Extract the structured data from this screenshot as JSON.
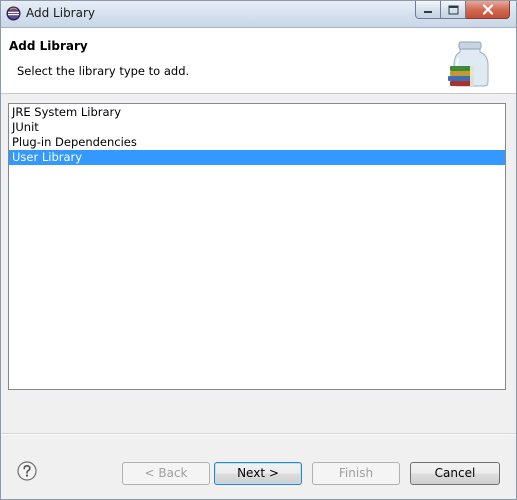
{
  "window": {
    "title": "Add Library",
    "controls": [
      "minimize",
      "maximize",
      "close"
    ]
  },
  "header": {
    "title": "Add Library",
    "description": "Select the library type to add."
  },
  "library_types": {
    "items": [
      {
        "label": "JRE System Library",
        "selected": false
      },
      {
        "label": "JUnit",
        "selected": false
      },
      {
        "label": "Plug-in Dependencies",
        "selected": false
      },
      {
        "label": "User Library",
        "selected": true
      }
    ]
  },
  "buttons": {
    "back": {
      "label": "< Back",
      "enabled": false
    },
    "next": {
      "label": "Next >",
      "enabled": true,
      "default": true
    },
    "finish": {
      "label": "Finish",
      "enabled": false
    },
    "cancel": {
      "label": "Cancel",
      "enabled": true
    }
  },
  "icons": {
    "app": "eclipse-icon",
    "banner": "library-jar-icon",
    "help": "help-icon"
  },
  "colors": {
    "selection": "#3399ff",
    "selection_text": "#ffffff",
    "close_button": "#c9563c",
    "title_bar": "#d4e0ee"
  }
}
